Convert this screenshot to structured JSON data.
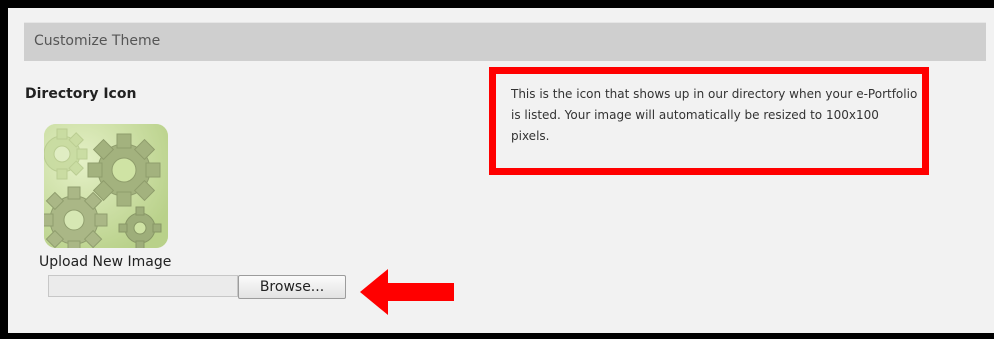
{
  "header": {
    "title": "Customize Theme"
  },
  "directory_icon": {
    "title": "Directory Icon",
    "help_text": "This is the icon that shows up in our directory when your e-Portfolio is listed. Your image will automatically be resized to 100x100 pixels.",
    "icon_name": "gears-icon"
  },
  "upload": {
    "label": "Upload New Image",
    "browse_label": "Browse...",
    "file_value": ""
  },
  "annotations": {
    "highlight_color": "#ff0000",
    "arrow_icon": "arrow-left-icon"
  }
}
